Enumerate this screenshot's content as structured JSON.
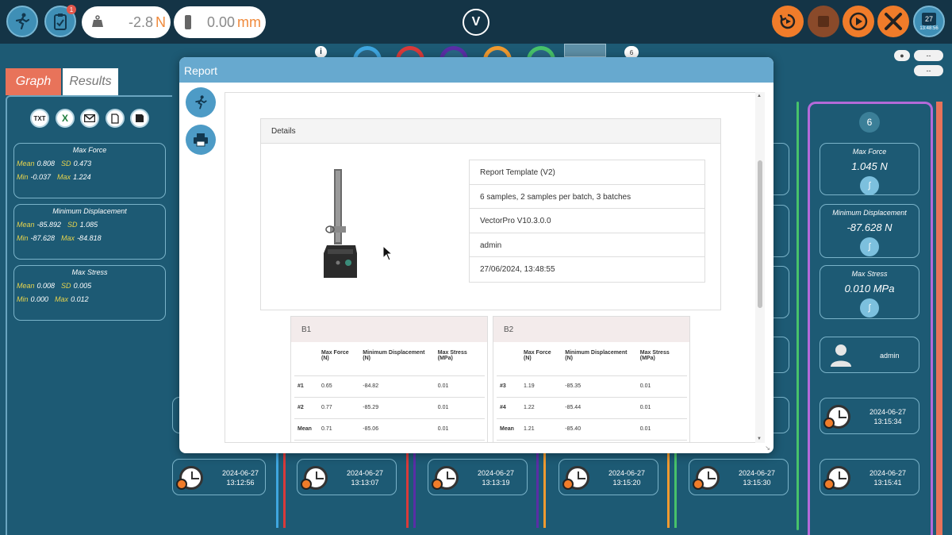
{
  "topbar": {
    "force_value": "-2.8",
    "force_unit": "N",
    "displacement_value": "0.00",
    "displacement_unit": "mm",
    "notification_count": "1",
    "calendar_day": "27",
    "clock_time": "13:48:56",
    "logo": "V"
  },
  "tabs": {
    "graph": "Graph",
    "results": "Results"
  },
  "sample_selector_count": "6",
  "small_buttons": {
    "b1": "--",
    "b2": "--"
  },
  "left_stats": [
    {
      "title": "Max Force",
      "mean_k": "Mean",
      "mean": "0.808",
      "sd_k": "SD",
      "sd": "0.473",
      "min_k": "Min",
      "min": "-0.037",
      "max_k": "Max",
      "max": "1.224"
    },
    {
      "title": "Minimum Displacement",
      "mean_k": "Mean",
      "mean": "-85.892",
      "sd_k": "SD",
      "sd": "1.085",
      "min_k": "Min",
      "min": "-87.628",
      "max_k": "Max",
      "max": "-84.818"
    },
    {
      "title": "Max Stress",
      "mean_k": "Mean",
      "mean": "0.008",
      "sd_k": "SD",
      "sd": "0.005",
      "min_k": "Min",
      "min": "0.000",
      "max_k": "Max",
      "max": "0.012"
    }
  ],
  "toolbar_icons": {
    "txt": "TXT",
    "excel": "X"
  },
  "right_panel": {
    "sample_number": "6",
    "max_force_title": "Max Force",
    "max_force_value": "1.045 N",
    "min_disp_title": "Minimum Displacement",
    "min_disp_value": "-87.628 N",
    "max_stress_title": "Max Stress",
    "max_stress_value": "0.010 MPa",
    "user": "admin",
    "top_ts_date": "2024-06-27",
    "top_ts_time": "13:15:34"
  },
  "bottom_runs": [
    {
      "date": "2024-06-27",
      "time": "13:12:56"
    },
    {
      "date": "2024-06-27",
      "time": "13:13:07"
    },
    {
      "date": "2024-06-27",
      "time": "13:13:19"
    },
    {
      "date": "2024-06-27",
      "time": "13:15:20"
    },
    {
      "date": "2024-06-27",
      "time": "13:15:30"
    },
    {
      "date": "2024-06-27",
      "time": "13:15:41"
    }
  ],
  "report": {
    "title": "Report",
    "details_title": "Details",
    "info": [
      "Report Template (V2)",
      "6 samples, 2 samples per batch, 3 batches",
      "VectorPro V10.3.0.0",
      "admin",
      "27/06/2024, 13:48:55"
    ],
    "batches": [
      {
        "name": "B1",
        "headers": [
          "",
          "Max Force (N)",
          "Minimum Displacement (N)",
          "Max Stress (MPa)"
        ],
        "rows": [
          [
            "#1",
            "0.65",
            "-84.82",
            "0.01"
          ],
          [
            "#2",
            "0.77",
            "-85.29",
            "0.01"
          ],
          [
            "Mean",
            "0.71",
            "-85.06",
            "0.01"
          ]
        ]
      },
      {
        "name": "B2",
        "headers": [
          "",
          "Max Force (N)",
          "Minimum Displacement (N)",
          "Max Stress (MPa)"
        ],
        "rows": [
          [
            "#3",
            "1.19",
            "-85.35",
            "0.01"
          ],
          [
            "#4",
            "1.22",
            "-85.44",
            "0.01"
          ],
          [
            "Mean",
            "1.21",
            "-85.40",
            "0.01"
          ]
        ]
      }
    ]
  },
  "colors": {
    "accent_orange": "#f07c2a",
    "report_header": "#67a9cf",
    "panel_bg": "#1d5a74",
    "sample_colors": [
      "#3fa6e0",
      "#d93a3a",
      "#5a2ea6",
      "#f09a30",
      "#47c26a",
      "#c45adf"
    ]
  }
}
